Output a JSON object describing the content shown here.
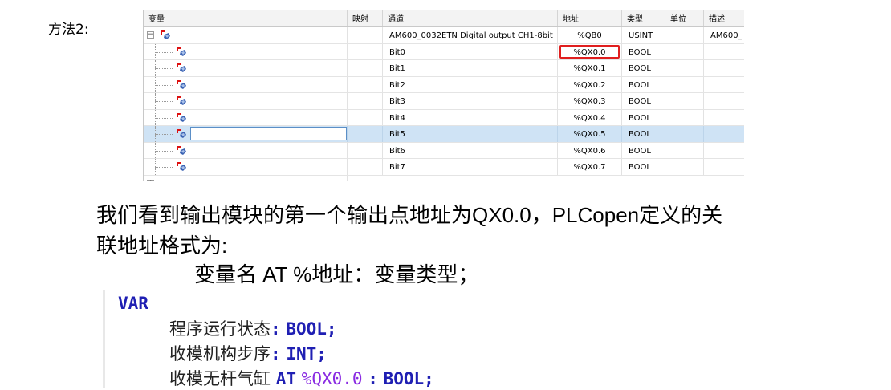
{
  "method_label": "方法2:",
  "table": {
    "headers": [
      "变量",
      "映射",
      "通道",
      "地址",
      "类型",
      "单位",
      "描述"
    ],
    "parent_row": {
      "channel": "AM600_0032ETN Digital output CH1-8bit",
      "address": "%QB0",
      "type": "USINT",
      "description": "AM600_"
    },
    "rows": [
      {
        "channel": "Bit0",
        "address": "%QX0.0",
        "type": "BOOL"
      },
      {
        "channel": "Bit1",
        "address": "%QX0.1",
        "type": "BOOL"
      },
      {
        "channel": "Bit2",
        "address": "%QX0.2",
        "type": "BOOL"
      },
      {
        "channel": "Bit3",
        "address": "%QX0.3",
        "type": "BOOL"
      },
      {
        "channel": "Bit4",
        "address": "%QX0.4",
        "type": "BOOL"
      },
      {
        "channel": "Bit5",
        "address": "%QX0.5",
        "type": "BOOL"
      },
      {
        "channel": "Bit6",
        "address": "%QX0.6",
        "type": "BOOL"
      },
      {
        "channel": "Bit7",
        "address": "%QX0.7",
        "type": "BOOL"
      }
    ],
    "selected_row": "Bit5",
    "highlighted_address": "%QX0.0",
    "highlight_color": "#e01e1e",
    "selection_color": "#cfe3f5"
  },
  "text": {
    "line1": "我们看到输出模块的第一个输出点地址为QX0.0，PLCopen定义的关",
    "line2": "联地址格式为:",
    "formula": "变量名  AT  %地址：变量类型；"
  },
  "code": {
    "keyword_var": "VAR",
    "lines": [
      {
        "name": "程序运行状态",
        "sep": ":",
        "type": "BOOL;"
      },
      {
        "name": "收模机构步序",
        "sep": ":",
        "type": "INT;"
      },
      {
        "name": "收模无杆气缸",
        "at": "AT",
        "address": "%QX0.0",
        "sep": ":",
        "type": "BOOL;"
      }
    ],
    "keyword_color": "#1f1fb3",
    "address_color": "#8a2be2"
  }
}
